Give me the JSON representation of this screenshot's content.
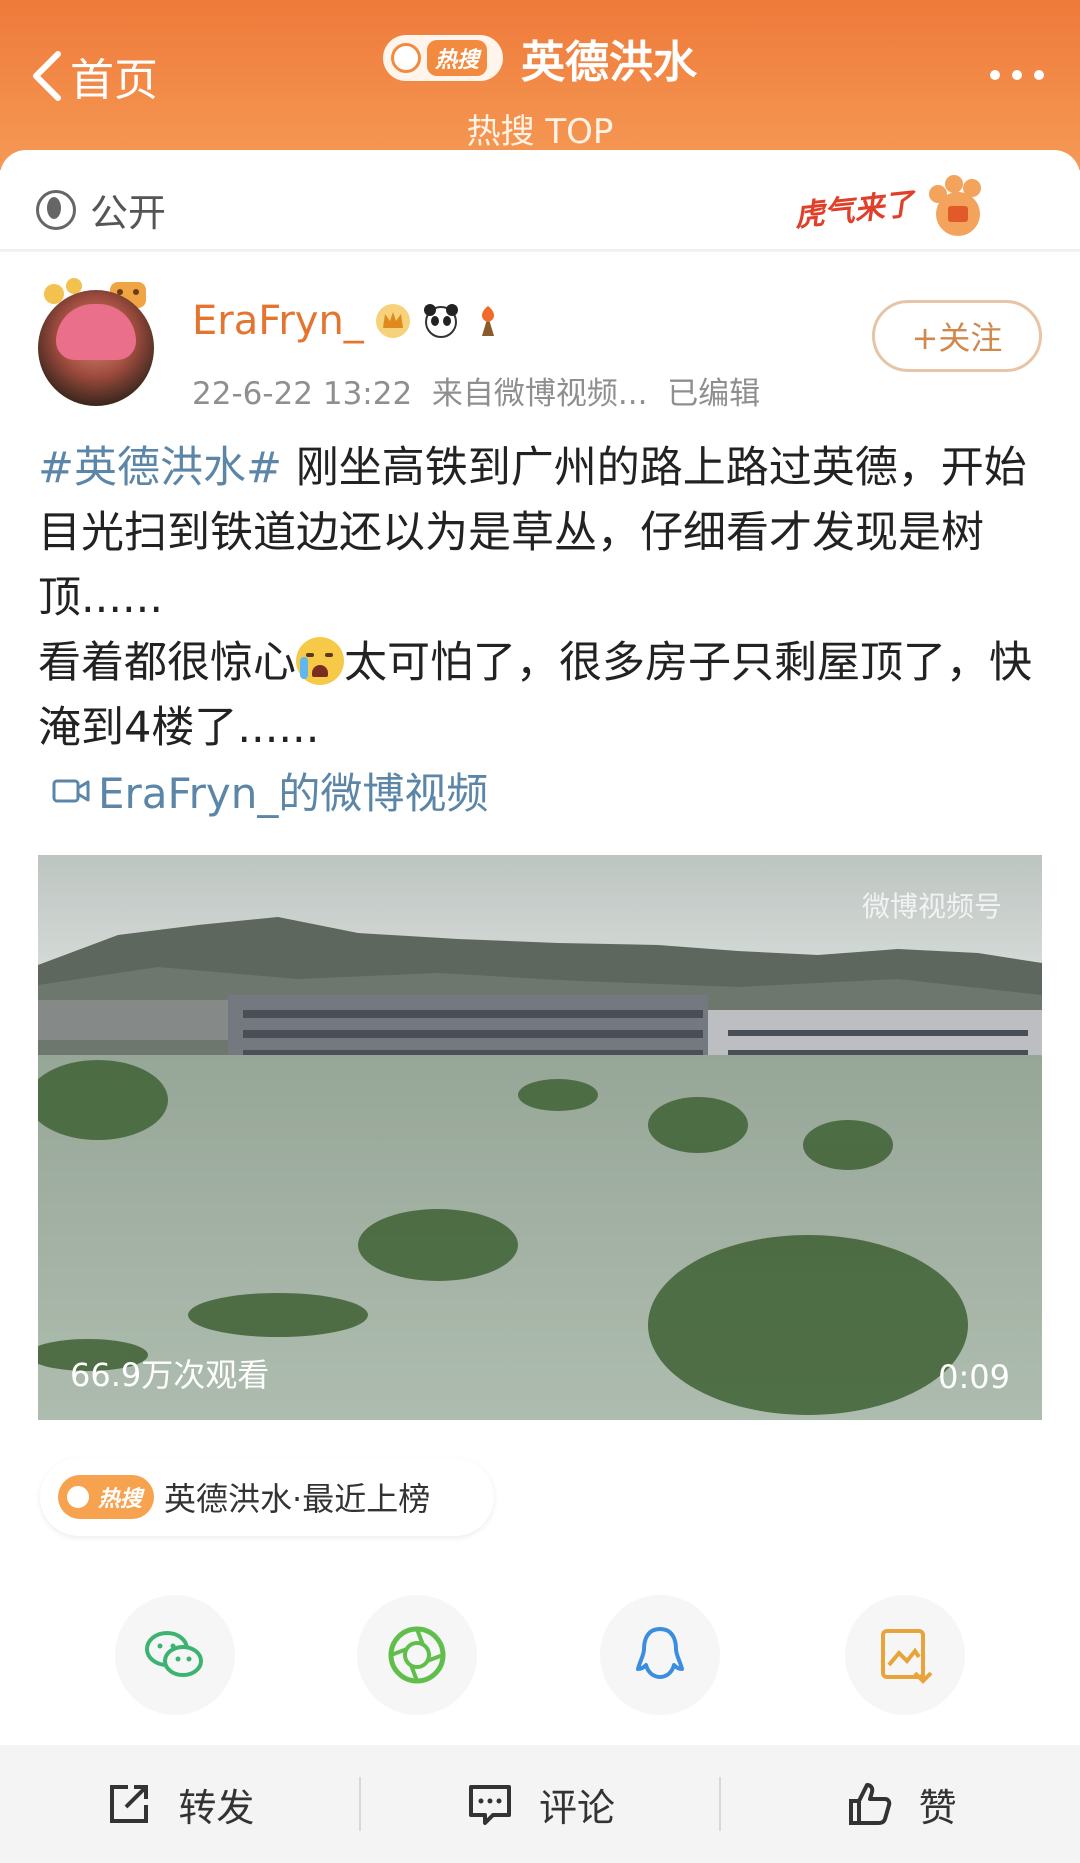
{
  "header": {
    "back_label": "首页",
    "hot_badge": "热搜",
    "title": "英德洪水",
    "subtitle": "热搜 TOP"
  },
  "visibility": "公开",
  "badge_text": "虎气来了",
  "post": {
    "username": "EraFryn_",
    "timestamp": "22-6-22 13:22",
    "source": "来自微博视频...",
    "edited": "已编辑",
    "follow_label": "+关注",
    "hashtag": "#英德洪水#",
    "text_part1": " 刚坐高铁到广州的路上路过英德，开始目光扫到铁道边还以为是草丛，仔细看才发现是树顶......",
    "text_part2": "看着都很惊心",
    "text_part3": "太可怕了，很多房子只剩屋顶了，快淹到4楼了......",
    "video_link": "EraFryn_的微博视频"
  },
  "video": {
    "views": "66.9万次观看",
    "duration": "0:09",
    "watermark": "微博视频号"
  },
  "hot_tag": {
    "badge": "热搜",
    "text": "英德洪水·最近上榜"
  },
  "share_icons": [
    "wechat-icon",
    "moments-icon",
    "qq-icon",
    "save-image-icon"
  ],
  "actions": {
    "repost": "转发",
    "comment": "评论",
    "like": "赞"
  },
  "colors": {
    "header": "#ef7a3a",
    "username": "#e4742f",
    "hashtag": "#5b86a8"
  }
}
